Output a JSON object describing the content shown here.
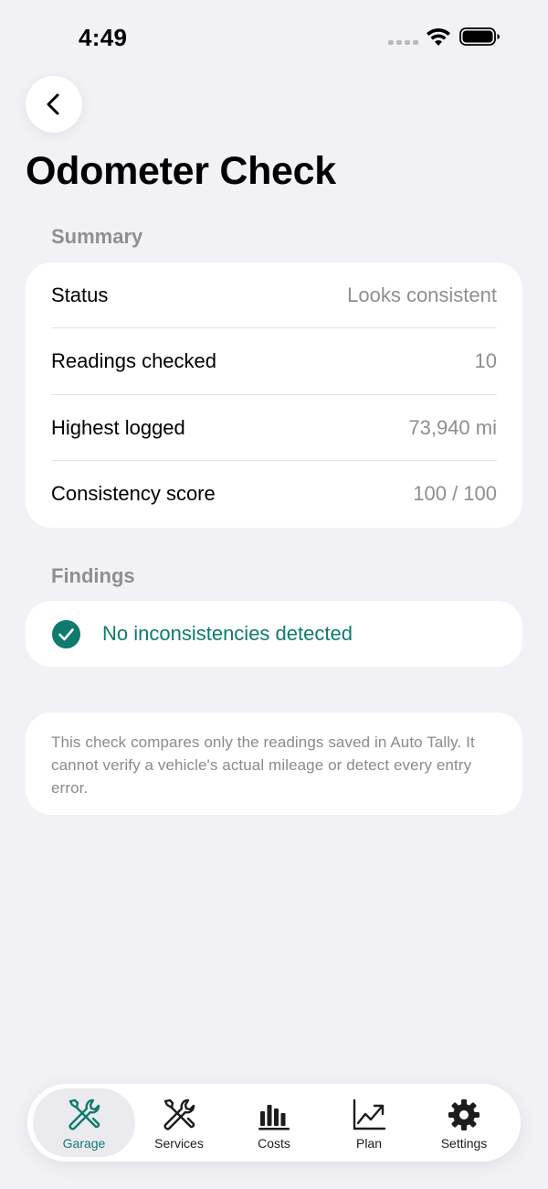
{
  "status_bar": {
    "time": "4:49"
  },
  "header": {
    "title": "Odometer Check"
  },
  "summary": {
    "section_title": "Summary",
    "rows": [
      {
        "label": "Status",
        "value": "Looks consistent"
      },
      {
        "label": "Readings checked",
        "value": "10"
      },
      {
        "label": "Highest logged",
        "value": "73,940 mi"
      },
      {
        "label": "Consistency score",
        "value": "100 / 100"
      }
    ]
  },
  "findings": {
    "section_title": "Findings",
    "message": "No inconsistencies detected",
    "icon": "checkmark-circle-icon"
  },
  "note": {
    "text": "This check compares only the readings saved in Auto Tally. It cannot verify a vehicle's actual mileage or detect every entry error."
  },
  "tab_bar": {
    "tabs": [
      {
        "label": "Garage",
        "icon": "wrench-screwdriver-icon",
        "active": true
      },
      {
        "label": "Services",
        "icon": "wrench-screwdriver-icon",
        "active": false
      },
      {
        "label": "Costs",
        "icon": "bar-chart-icon",
        "active": false
      },
      {
        "label": "Plan",
        "icon": "trend-chart-icon",
        "active": false
      },
      {
        "label": "Settings",
        "icon": "gear-icon",
        "active": false
      }
    ]
  },
  "colors": {
    "background": "#F1F1F6",
    "accent": "#0F7A6E",
    "secondary_text": "#8E8E93",
    "card": "#FFFFFF"
  }
}
